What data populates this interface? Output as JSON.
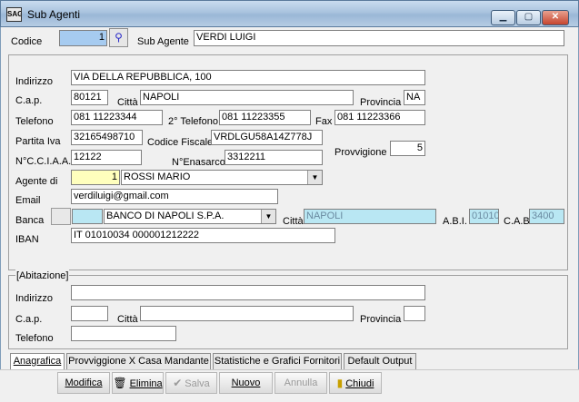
{
  "window": {
    "title": "Sub Agenti",
    "icon_text": "SAG"
  },
  "header": {
    "codice_label": "Codice",
    "codice_value": "1",
    "subagente_label": "Sub Agente",
    "subagente_value": "VERDI LUIGI"
  },
  "main": {
    "indirizzo_label": "Indirizzo",
    "indirizzo_value": "VIA DELLA REPUBBLICA, 100",
    "cap_label": "C.a.p.",
    "cap_value": "80121",
    "citta_label": "Città",
    "citta_value": "NAPOLI",
    "provincia_label": "Provincia",
    "provincia_value": "NA",
    "telefono_label": "Telefono",
    "telefono_value": "081 11223344",
    "telefono2_label": "2° Telefono",
    "telefono2_value": "081 11223355",
    "fax_label": "Fax",
    "fax_value": "081 11223366",
    "piva_label": "Partita Iva",
    "piva_value": "32165498710",
    "codfisc_label": "Codice Fiscale",
    "codfisc_value": "VRDLGU58A14Z778J",
    "provvigione_label": "Provvigione",
    "provvigione_value": "5",
    "cciaa_label": "N°C.C.I.A.A.",
    "cciaa_value": "12122",
    "enasarco_label": "N°Enasarco",
    "enasarco_value": "3312211",
    "agente_label": "Agente di",
    "agente_code": "1",
    "agente_name": "ROSSI MARIO",
    "email_label": "Email",
    "email_value": "verdiluigi@gmail.com",
    "banca_label": "Banca",
    "banca_name": "BANCO DI NAPOLI S.P.A.",
    "banca_citta_label": "Città",
    "banca_citta_value": "NAPOLI",
    "abi_label": "A.B.I.",
    "abi_value": "01010",
    "cab_label": "C.A.B.",
    "cab_value": "3400",
    "iban_label": "IBAN",
    "iban_value": "IT 01010034 000001212222"
  },
  "abitazione": {
    "title": "[Abitazione]",
    "indirizzo_label": "Indirizzo",
    "cap_label": "C.a.p.",
    "citta_label": "Città",
    "provincia_label": "Provincia",
    "telefono_label": "Telefono"
  },
  "tabs": [
    {
      "label": "Anagrafica",
      "active": true
    },
    {
      "label": "Provviggione X Casa Mandante",
      "active": false
    },
    {
      "label": "Statistiche e Grafici Fornitori",
      "active": false
    },
    {
      "label": "Default Output",
      "active": false
    }
  ],
  "toolbar": {
    "modifica": "Modifica",
    "elimina": "Elimina",
    "salva": "Salva",
    "nuovo": "Nuovo",
    "annulla": "Annulla",
    "chiudi": "Chiudi"
  },
  "colors": {
    "titlebar": "#a9c3de",
    "key_field": "#a6cbf0",
    "readonly_field": "#b9e7f3",
    "agente_field": "#ffffbd"
  }
}
